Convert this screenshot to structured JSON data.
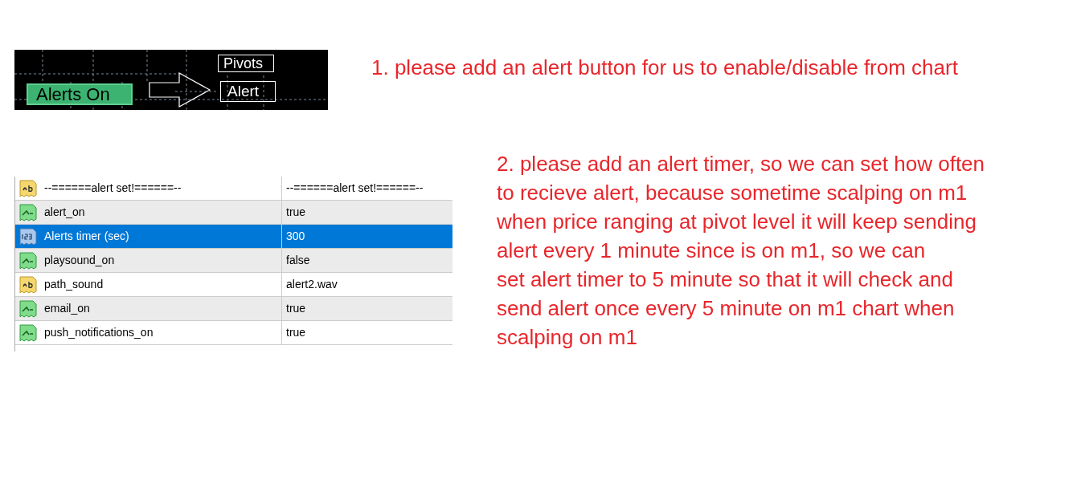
{
  "chart": {
    "alerts_button": "Alerts On",
    "pivots_label": "Pivots",
    "alert_label": "Alert"
  },
  "note_1": "1. please add an alert button for us to enable/disable from chart",
  "parameters": [
    {
      "kind": "string",
      "name": "--======alert set!======--",
      "value": "--======alert set!======--",
      "selected": false
    },
    {
      "kind": "bool",
      "name": "alert_on",
      "value": "true",
      "selected": false
    },
    {
      "kind": "int",
      "name": "Alerts timer (sec)",
      "value": "300",
      "selected": true
    },
    {
      "kind": "bool",
      "name": "playsound_on",
      "value": "false",
      "selected": false
    },
    {
      "kind": "string",
      "name": "path_sound",
      "value": "alert2.wav",
      "selected": false
    },
    {
      "kind": "bool",
      "name": "email_on",
      "value": "true",
      "selected": false
    },
    {
      "kind": "bool",
      "name": "push_notifications_on",
      "value": "true",
      "selected": false
    }
  ],
  "note_2": [
    "2. please add an alert timer, so we can set how often",
    "to recieve alert, because sometime scalping on m1",
    "when price ranging at pivot level it will keep sending",
    "alert every 1 minute since is on m1, so we can",
    "set alert timer to 5 minute so that it will check and",
    "send alert once every 5 minute on m1 chart when",
    "scalping on m1"
  ]
}
